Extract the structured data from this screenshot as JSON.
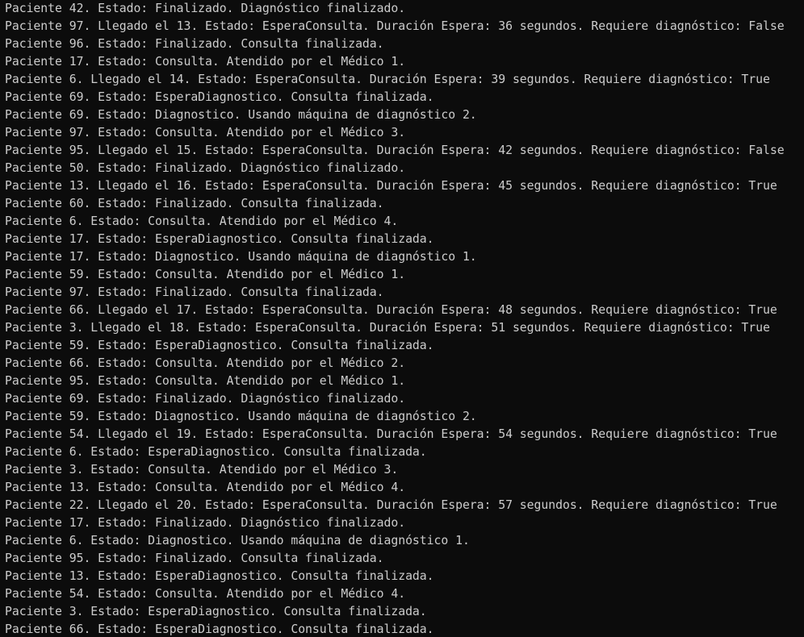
{
  "console": {
    "lines": [
      "Paciente 42. Estado: Finalizado. Diagnóstico finalizado.",
      "Paciente 97. Llegado el 13. Estado: EsperaConsulta. Duración Espera: 36 segundos. Requiere diagnóstico: False",
      "Paciente 96. Estado: Finalizado. Consulta finalizada.",
      "Paciente 17. Estado: Consulta. Atendido por el Médico 1.",
      "Paciente 6. Llegado el 14. Estado: EsperaConsulta. Duración Espera: 39 segundos. Requiere diagnóstico: True",
      "Paciente 69. Estado: EsperaDiagnostico. Consulta finalizada.",
      "Paciente 69. Estado: Diagnostico. Usando máquina de diagnóstico 2.",
      "Paciente 97. Estado: Consulta. Atendido por el Médico 3.",
      "Paciente 95. Llegado el 15. Estado: EsperaConsulta. Duración Espera: 42 segundos. Requiere diagnóstico: False",
      "Paciente 50. Estado: Finalizado. Diagnóstico finalizado.",
      "Paciente 13. Llegado el 16. Estado: EsperaConsulta. Duración Espera: 45 segundos. Requiere diagnóstico: True",
      "Paciente 60. Estado: Finalizado. Consulta finalizada.",
      "Paciente 6. Estado: Consulta. Atendido por el Médico 4.",
      "Paciente 17. Estado: EsperaDiagnostico. Consulta finalizada.",
      "Paciente 17. Estado: Diagnostico. Usando máquina de diagnóstico 1.",
      "Paciente 59. Estado: Consulta. Atendido por el Médico 1.",
      "Paciente 97. Estado: Finalizado. Consulta finalizada.",
      "Paciente 66. Llegado el 17. Estado: EsperaConsulta. Duración Espera: 48 segundos. Requiere diagnóstico: True",
      "Paciente 3. Llegado el 18. Estado: EsperaConsulta. Duración Espera: 51 segundos. Requiere diagnóstico: True",
      "Paciente 59. Estado: EsperaDiagnostico. Consulta finalizada.",
      "Paciente 66. Estado: Consulta. Atendido por el Médico 2.",
      "Paciente 95. Estado: Consulta. Atendido por el Médico 1.",
      "Paciente 69. Estado: Finalizado. Diagnóstico finalizado.",
      "Paciente 59. Estado: Diagnostico. Usando máquina de diagnóstico 2.",
      "Paciente 54. Llegado el 19. Estado: EsperaConsulta. Duración Espera: 54 segundos. Requiere diagnóstico: True",
      "Paciente 6. Estado: EsperaDiagnostico. Consulta finalizada.",
      "Paciente 3. Estado: Consulta. Atendido por el Médico 3.",
      "Paciente 13. Estado: Consulta. Atendido por el Médico 4.",
      "Paciente 22. Llegado el 20. Estado: EsperaConsulta. Duración Espera: 57 segundos. Requiere diagnóstico: True",
      "Paciente 17. Estado: Finalizado. Diagnóstico finalizado.",
      "Paciente 6. Estado: Diagnostico. Usando máquina de diagnóstico 1.",
      "Paciente 95. Estado: Finalizado. Consulta finalizada.",
      "Paciente 13. Estado: EsperaDiagnostico. Consulta finalizada.",
      "Paciente 54. Estado: Consulta. Atendido por el Médico 4.",
      "Paciente 3. Estado: EsperaDiagnostico. Consulta finalizada.",
      "Paciente 66. Estado: EsperaDiagnostico. Consulta finalizada."
    ]
  },
  "colors": {
    "background": "#0c0c0c",
    "text": "#cccccc"
  }
}
